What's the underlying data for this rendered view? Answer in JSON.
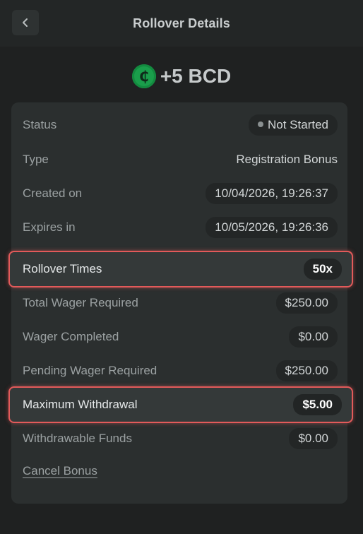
{
  "header": {
    "title": "Rollover Details"
  },
  "bonus": {
    "amount": "+5 BCD",
    "coin_symbol": "₵",
    "coin_color": "#1a9e4b"
  },
  "details": {
    "status": {
      "label": "Status",
      "value": "Not Started"
    },
    "type": {
      "label": "Type",
      "value": "Registration Bonus"
    },
    "created_on": {
      "label": "Created on",
      "value": "10/04/2026, 19:26:37"
    },
    "expires_in": {
      "label": "Expires in",
      "value": "10/05/2026, 19:26:36"
    },
    "rollover_times": {
      "label": "Rollover Times",
      "value": "50x"
    },
    "total_wager_required": {
      "label": "Total Wager Required",
      "value": "$250.00"
    },
    "wager_completed": {
      "label": "Wager Completed",
      "value": "$0.00"
    },
    "pending_wager_required": {
      "label": "Pending Wager Required",
      "value": "$250.00"
    },
    "maximum_withdrawal": {
      "label": "Maximum Withdrawal",
      "value": "$5.00"
    },
    "withdrawable_funds": {
      "label": "Withdrawable Funds",
      "value": "$0.00"
    }
  },
  "actions": {
    "cancel_bonus": "Cancel Bonus"
  },
  "colors": {
    "highlight_border": "#e25a5a",
    "background": "#1f2121",
    "card": "#2b2f2f"
  }
}
